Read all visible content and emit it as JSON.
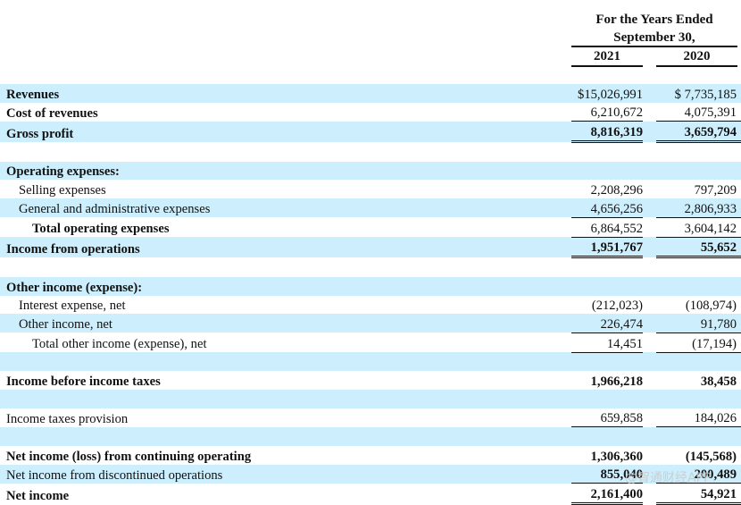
{
  "header": {
    "line1": "For the Years Ended",
    "line2": "September 30,",
    "years": [
      "2021",
      "2020"
    ]
  },
  "rows": [
    {
      "label": "Revenues",
      "v2021": "$15,026,991",
      "v2020": "$ 7,735,185"
    },
    {
      "label": "Cost of revenues",
      "v2021": "6,210,672",
      "v2020": "4,075,391"
    },
    {
      "label": "Gross profit",
      "v2021": "8,816,319",
      "v2020": "3,659,794"
    },
    {
      "label": "Operating expenses:"
    },
    {
      "label": "Selling expenses",
      "v2021": "2,208,296",
      "v2020": "797,209"
    },
    {
      "label": "General and administrative expenses",
      "v2021": "4,656,256",
      "v2020": "2,806,933"
    },
    {
      "label": "Total operating expenses",
      "v2021": "6,864,552",
      "v2020": "3,604,142"
    },
    {
      "label": "Income from operations",
      "v2021": "1,951,767",
      "v2020": "55,652"
    },
    {
      "label": "Other income (expense):"
    },
    {
      "label": "Interest expense, net",
      "v2021": "(212,023)",
      "v2020": "(108,974)"
    },
    {
      "label": "Other income, net",
      "v2021": "226,474",
      "v2020": "91,780"
    },
    {
      "label": "Total other income (expense), net",
      "v2021": "14,451",
      "v2020": "(17,194)"
    },
    {
      "label": "Income before income taxes",
      "v2021": "1,966,218",
      "v2020": "38,458"
    },
    {
      "label": "Income taxes provision",
      "v2021": "659,858",
      "v2020": "184,026"
    },
    {
      "label": "Net income (loss) from continuing operating",
      "v2021": "1,306,360",
      "v2020": "(145,568)"
    },
    {
      "label": "Net income from discontinued operations",
      "v2021": "855,040",
      "v2020": "200,489"
    },
    {
      "label": "Net income",
      "v2021": "2,161,400",
      "v2020": "54,921"
    }
  ],
  "watermark": "@智通财经APP"
}
